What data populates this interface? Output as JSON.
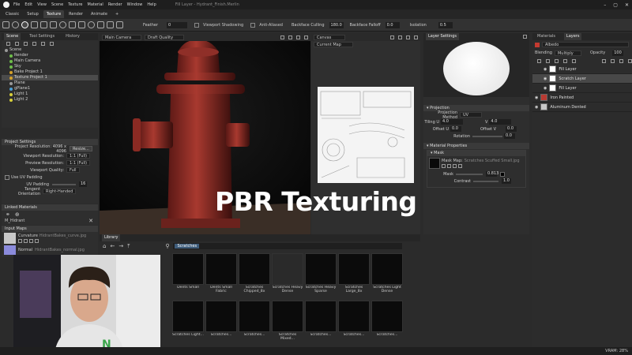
{
  "app": {
    "title": "Fill Layer - Hydrant_Finish.Merlin",
    "menu": [
      "File",
      "Edit",
      "View",
      "Scene",
      "Texture",
      "Material",
      "Render",
      "Window",
      "Help"
    ],
    "tabs": [
      "Classic",
      "Setup",
      "Texture",
      "Render",
      "Animate",
      "+"
    ],
    "active_tab": "Texture"
  },
  "toolbar": {
    "feather_label": "Feather",
    "feather_value": "0",
    "viewport_shadowing": "Viewport Shadowing",
    "anti_aliased": "Anti-Aliased",
    "backface_culling": "Backface Culling",
    "backface_culling_value": "180.0",
    "backface_falloff": "Backface Falloff",
    "backface_falloff_value": "0.0",
    "isolation": "Isolation",
    "isolation_value": "0.5"
  },
  "scene_panel": {
    "tabs": [
      "Scene",
      "Tool Settings",
      "History"
    ],
    "items": [
      {
        "label": "Scene",
        "color": "#9a9a9a"
      },
      {
        "label": "Render",
        "color": "#6fbf4a"
      },
      {
        "label": "Main Camera",
        "color": "#6fbf4a"
      },
      {
        "label": "Sky",
        "color": "#6fbf4a"
      },
      {
        "label": "Bake Project 1",
        "color": "#d4a12a"
      },
      {
        "label": "Texture Project 1",
        "color": "#d4a12a"
      },
      {
        "label": "Plane",
        "color": "#9a9a9a"
      },
      {
        "label": "gPlane1",
        "color": "#4aa0d8"
      },
      {
        "label": "Light 1",
        "color": "#d8d03a"
      },
      {
        "label": "Light 2",
        "color": "#d8d03a"
      }
    ]
  },
  "project_settings": {
    "header": "Project Settings",
    "project_resolution_label": "Project Resolution: 4096 x 4096",
    "resize_button": "Resize...",
    "viewport_resolution_label": "Viewport Resolution:",
    "viewport_resolution_value": "1:1 (Full)",
    "preview_resolution_label": "Preview Resolution:",
    "preview_resolution_value": "1:1 (Full)",
    "viewport_quality_label": "Viewport Quality:",
    "viewport_quality_value": "Full",
    "use_uv_padding": "Use UV Padding",
    "uv_padding_label": "UV Padding",
    "uv_padding_value": "16",
    "tangent_orientation_label": "Tangent Orientation",
    "tangent_orientation_value": "Right-Handed"
  },
  "linked_materials": {
    "header": "Linked Materials",
    "item": "M_Hidrant"
  },
  "input_maps": {
    "header": "Input Maps",
    "curvature_label": "Curvature",
    "curvature_file": "HidrantBakes_curve.jpg",
    "normal_label": "Normal",
    "normal_file": "HidrantBakes_normal.jpg"
  },
  "viewport": {
    "camera": "Main Camera",
    "quality": "Draft Quality"
  },
  "uv_view": {
    "mode": "Canvas",
    "map": "Current Map"
  },
  "layer_settings": {
    "title": "Layer Settings",
    "projection_header": "Projection",
    "projection_method_label": "Projection Method",
    "projection_method_value": "UV",
    "tiling_u_label": "Tiling U",
    "tiling_u_value": "4.0",
    "tiling_v_label": "V",
    "tiling_v_value": "4.0",
    "offset_u_label": "Offset U",
    "offset_u_value": "0.0",
    "offset_v_label": "Offset V",
    "offset_v_value": "0.0",
    "rotation_label": "Rotation",
    "rotation_value": "0.0",
    "material_properties_header": "Material Properties",
    "mask_header": "Mask",
    "mask_map_label": "Mask Map:",
    "mask_map_file": "Scratches Scuffed Small.jpg",
    "mask_label": "Mask",
    "mask_value": "0.813",
    "contrast_label": "Contrast",
    "contrast_value": "1.0"
  },
  "layers_panel": {
    "tabs": [
      "Materials",
      "Layers"
    ],
    "channel": "Albedo",
    "blending_label": "Blending",
    "blending_value": "Multiply",
    "opacity_label": "Opacity",
    "opacity_value": "100",
    "items": [
      {
        "label": "Fill Layer",
        "thumb": "#ffffff"
      },
      {
        "label": "Scratch Layer",
        "thumb": "#ffffff"
      },
      {
        "label": "Fill Layer",
        "thumb": "#ffffff"
      },
      {
        "label": "Iron Painted",
        "thumb": "#b83a32"
      },
      {
        "label": "Aluminum Dented",
        "thumb": "#c8c8c8"
      }
    ]
  },
  "library": {
    "title": "Library",
    "search_tag": "Scratches",
    "row1": [
      "Dents Small",
      "Dents Small Fabric",
      "Scratches Chipped_8x",
      "Scratches Heavy Dense",
      "Scratches Heavy Sparse",
      "Scratches Large_8x",
      "Scratches Light Dense"
    ],
    "row2": [
      "Scratches Light...",
      "Scratches...",
      "Scratches...",
      "Scratches Mixed...",
      "Scratches...",
      "Scratches...",
      "Scratches..."
    ]
  },
  "overlay": {
    "text": "PBR Texturing"
  },
  "status": {
    "vram": "VRAM: 28%"
  }
}
